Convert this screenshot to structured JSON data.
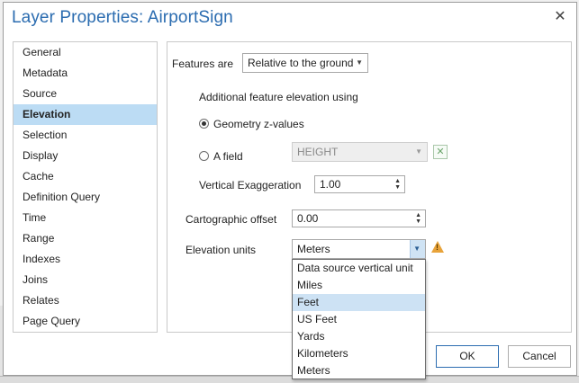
{
  "dialog": {
    "title": "Layer Properties: AirportSign",
    "close_glyph": "✕"
  },
  "nav": {
    "items": [
      {
        "label": "General"
      },
      {
        "label": "Metadata"
      },
      {
        "label": "Source"
      },
      {
        "label": "Elevation",
        "selected": true
      },
      {
        "label": "Selection"
      },
      {
        "label": "Display"
      },
      {
        "label": "Cache"
      },
      {
        "label": "Definition Query"
      },
      {
        "label": "Time"
      },
      {
        "label": "Range"
      },
      {
        "label": "Indexes"
      },
      {
        "label": "Joins"
      },
      {
        "label": "Relates"
      },
      {
        "label": "Page Query"
      }
    ]
  },
  "elevation": {
    "features_are_label": "Features are",
    "features_are_value": "Relative to the ground",
    "additional_label": "Additional feature elevation using",
    "geometry_option": "Geometry z-values",
    "field_option": "A field",
    "field_value": "HEIGHT",
    "vertical_exaggeration_label": "Vertical Exaggeration",
    "vertical_exaggeration_value": "1.00",
    "cartographic_offset_label": "Cartographic offset",
    "cartographic_offset_value": "0.00",
    "units_label": "Elevation units",
    "units_value": "Meters",
    "units_options": [
      "Data source vertical unit",
      "Miles",
      "Feet",
      "US Feet",
      "Yards",
      "Kilometers",
      "Meters"
    ],
    "highlighted_option": "Feet",
    "warning_icon": "warning-icon",
    "colors": {
      "accent": "#2b6cb0",
      "selection": "#bcdcf4",
      "warning": "#e8a33a"
    }
  },
  "buttons": {
    "ok": "OK",
    "cancel": "Cancel"
  }
}
